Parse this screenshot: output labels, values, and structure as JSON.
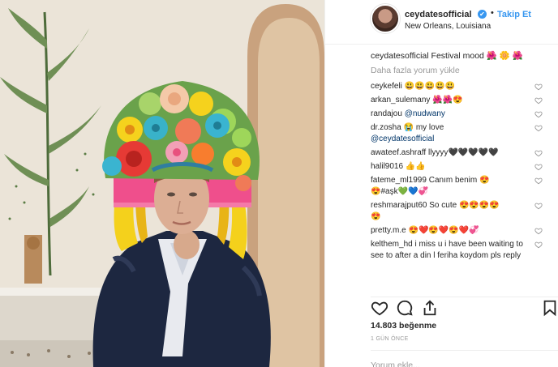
{
  "header": {
    "username": "ceydatesofficial",
    "verified_mark": "✔",
    "separator": "•",
    "follow_label": "Takip Et",
    "location": "New Orleans, Louisiana",
    "avatar_icon": "profile-avatar"
  },
  "caption": {
    "username": "ceydatesofficial",
    "text": "Festival mood",
    "emoji": "🌺 🌼 🌺"
  },
  "load_more_label": "Daha fazla yorum yükle",
  "comments": [
    {
      "username": "ceykefeli",
      "text": "",
      "emoji": "😃😃😃😃😃",
      "mention": ""
    },
    {
      "username": "arkan_sulemany",
      "text": "",
      "emoji": "🌺🌺😍",
      "mention": ""
    },
    {
      "username": "randajou",
      "text": "",
      "emoji": "",
      "mention": "@nudwany"
    },
    {
      "username": "dr.zosha",
      "text": "",
      "emoji": "😭",
      "mention": "",
      "after": "my love",
      "mention2": "@ceydatesofficial"
    },
    {
      "username": "awateef.ashraff",
      "text": "llyyyy",
      "emoji": "🖤🖤🖤🖤🖤",
      "mention": ""
    },
    {
      "username": "halil9016",
      "text": "",
      "emoji": "👍👍",
      "mention": ""
    },
    {
      "username": "fateme_ml1999",
      "text": "Canım benim",
      "emoji": "😍",
      "mention": "",
      "after": "😍#aşk💚💙💞"
    },
    {
      "username": "reshmarajput60",
      "text": "So cute",
      "emoji": "😍😍😍😍",
      "mention": "",
      "after": "😍"
    },
    {
      "username": "pretty.m.e",
      "text": "",
      "emoji": "😍❤️😍❤️😍❤️💞",
      "mention": ""
    },
    {
      "username": "kelthem_hd",
      "text": "i miss u i have been waiting to see to after a din l feriha koydom pls reply",
      "emoji": "",
      "mention": ""
    }
  ],
  "actions": {
    "like_icon": "heart-icon",
    "comment_icon": "comment-icon",
    "share_icon": "share-icon",
    "save_icon": "bookmark-icon"
  },
  "likes_label": "14.803 beğenme",
  "time_label": "1 GÜN ÖNCE",
  "comment_input": {
    "placeholder": "Yorum ekle..."
  },
  "colors": {
    "link_blue": "#3897f0",
    "mention_blue": "#003569",
    "muted_gray": "#999999",
    "text": "#262626"
  }
}
